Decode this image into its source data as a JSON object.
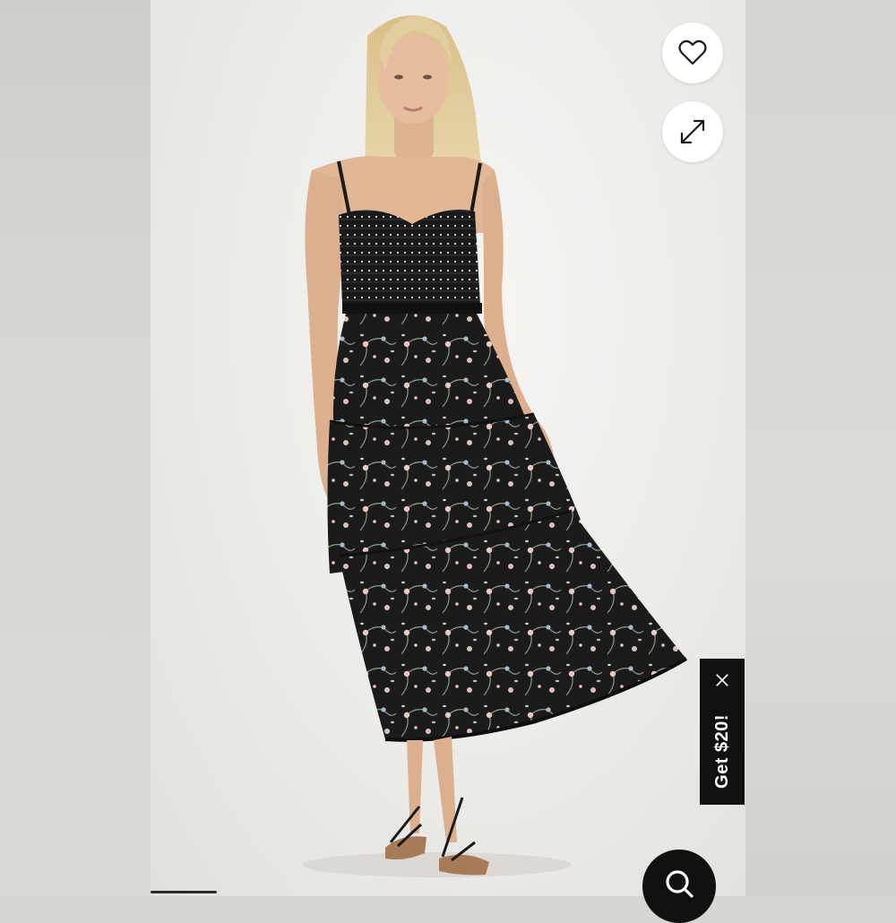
{
  "product_image": {
    "dress_color": "#1c1b1c",
    "print_colors": [
      "#e8c9c4",
      "#a9bccd",
      "#d9c2bd"
    ],
    "skin_color": "#e2b796",
    "hair_color": "#e2cd9e"
  },
  "actions": {
    "wishlist_icon": "heart-icon",
    "expand_icon": "expand-arrows-icon"
  },
  "promo": {
    "label": "Get $20!",
    "close_icon": "close-icon",
    "background": "#111111"
  },
  "search": {
    "icon": "search-icon",
    "background": "#111111"
  }
}
